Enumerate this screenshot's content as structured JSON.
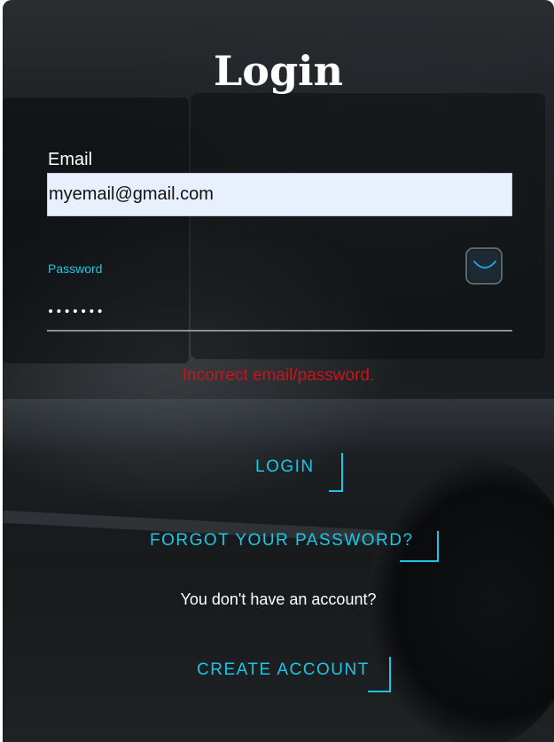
{
  "title": "Login",
  "email": {
    "label": "Email",
    "value": "myemail@gmail.com"
  },
  "password": {
    "label": "Password",
    "value": "•••••••",
    "toggle_icon": "eye-closed-icon"
  },
  "error_message": "Incorrect email/password.",
  "login_button": "LOGIN",
  "forgot_button": "FORGOT YOUR PASSWORD?",
  "no_account_text": "You don't have an account?",
  "create_account_button": "CREATE ACCOUNT",
  "colors": {
    "accent": "#19c8e8",
    "error": "#c9141c",
    "input_bg": "#e8f0fe"
  }
}
